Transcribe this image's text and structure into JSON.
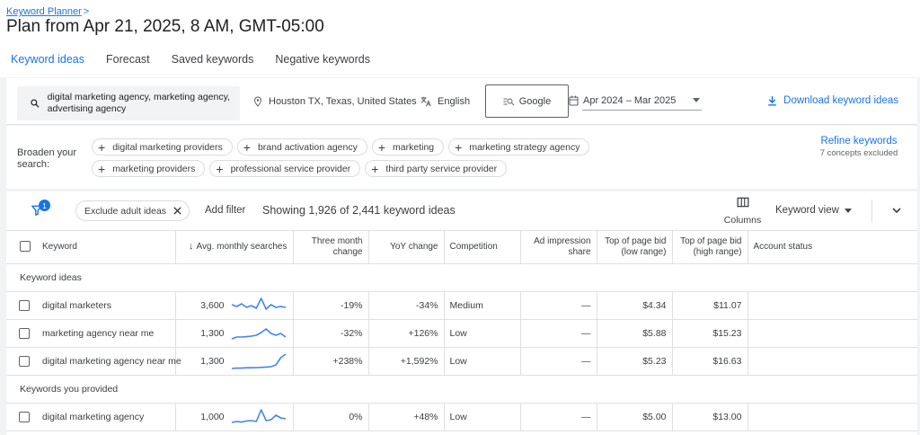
{
  "breadcrumb": {
    "label": "Keyword Planner",
    "chevron": ">"
  },
  "page_title": "Plan from Apr 21, 2025, 8 AM, GMT-05:00",
  "tabs": [
    {
      "label": "Keyword ideas",
      "active": true
    },
    {
      "label": "Forecast",
      "active": false
    },
    {
      "label": "Saved keywords",
      "active": false
    },
    {
      "label": "Negative keywords",
      "active": false
    }
  ],
  "filters": {
    "search_terms": "digital marketing agency, marketing agency, advertising agency",
    "location": "Houston TX, Texas, United States",
    "language": "English",
    "network": "Google",
    "date_range": "Apr 2024 – Mar 2025",
    "download_label": "Download keyword ideas"
  },
  "broaden": {
    "label": "Broaden your search:",
    "chips": [
      "digital marketing providers",
      "brand activation agency",
      "marketing",
      "marketing strategy agency",
      "marketing providers",
      "professional service provider",
      "third party service provider"
    ],
    "refine_label": "Refine keywords",
    "refine_sub": "7 concepts excluded"
  },
  "toolbar": {
    "filter_count": "1",
    "exclude_chip": "Exclude adult ideas",
    "add_filter": "Add filter",
    "showing": "Showing 1,926 of 2,441 keyword ideas",
    "columns_label": "Columns",
    "view_label": "Keyword view"
  },
  "table": {
    "headers": {
      "keyword": "Keyword",
      "avg": "Avg. monthly searches",
      "three_month_1": "Three month",
      "three_month_2": "change",
      "yoy": "YoY change",
      "competition": "Competition",
      "impression_1": "Ad impression",
      "impression_2": "share",
      "low_1": "Top of page bid",
      "low_2": "(low range)",
      "high_1": "Top of page bid",
      "high_2": "(high range)",
      "status": "Account status"
    },
    "group1": "Keyword ideas",
    "group2": "Keywords you provided",
    "rows": [
      {
        "keyword": "digital marketers",
        "avg": "3,600",
        "three_month": "-19%",
        "yoy": "-34%",
        "competition": "Medium",
        "impression": "—",
        "low": "$4.34",
        "high": "$11.07",
        "trend": [
          0.55,
          0.45,
          0.6,
          0.4,
          0.5,
          0.35,
          0.9,
          0.3,
          0.55,
          0.4,
          0.45,
          0.4
        ]
      },
      {
        "keyword": "marketing agency near me",
        "avg": "1,300",
        "three_month": "-32%",
        "yoy": "+126%",
        "competition": "Low",
        "impression": "—",
        "low": "$5.88",
        "high": "$15.23",
        "trend": [
          0.2,
          0.3,
          0.3,
          0.32,
          0.35,
          0.4,
          0.55,
          0.75,
          0.5,
          0.4,
          0.5,
          0.3
        ]
      },
      {
        "keyword": "digital marketing agency near me",
        "avg": "1,300",
        "three_month": "+238%",
        "yoy": "+1,592%",
        "competition": "Low",
        "impression": "—",
        "low": "$5.23",
        "high": "$16.63",
        "trend": [
          0.1,
          0.12,
          0.12,
          0.14,
          0.14,
          0.15,
          0.16,
          0.18,
          0.2,
          0.3,
          0.7,
          0.9
        ]
      }
    ],
    "provided_rows": [
      {
        "keyword": "digital marketing agency",
        "avg": "1,000",
        "three_month": "0%",
        "yoy": "+48%",
        "competition": "Low",
        "impression": "—",
        "low": "$5.00",
        "high": "$13.00",
        "trend": [
          0.2,
          0.25,
          0.22,
          0.28,
          0.3,
          0.25,
          0.9,
          0.3,
          0.35,
          0.6,
          0.45,
          0.4
        ]
      }
    ]
  },
  "colors": {
    "accent": "#1a73e8",
    "text": "#3c4043",
    "sparkline": "#4285f4"
  }
}
